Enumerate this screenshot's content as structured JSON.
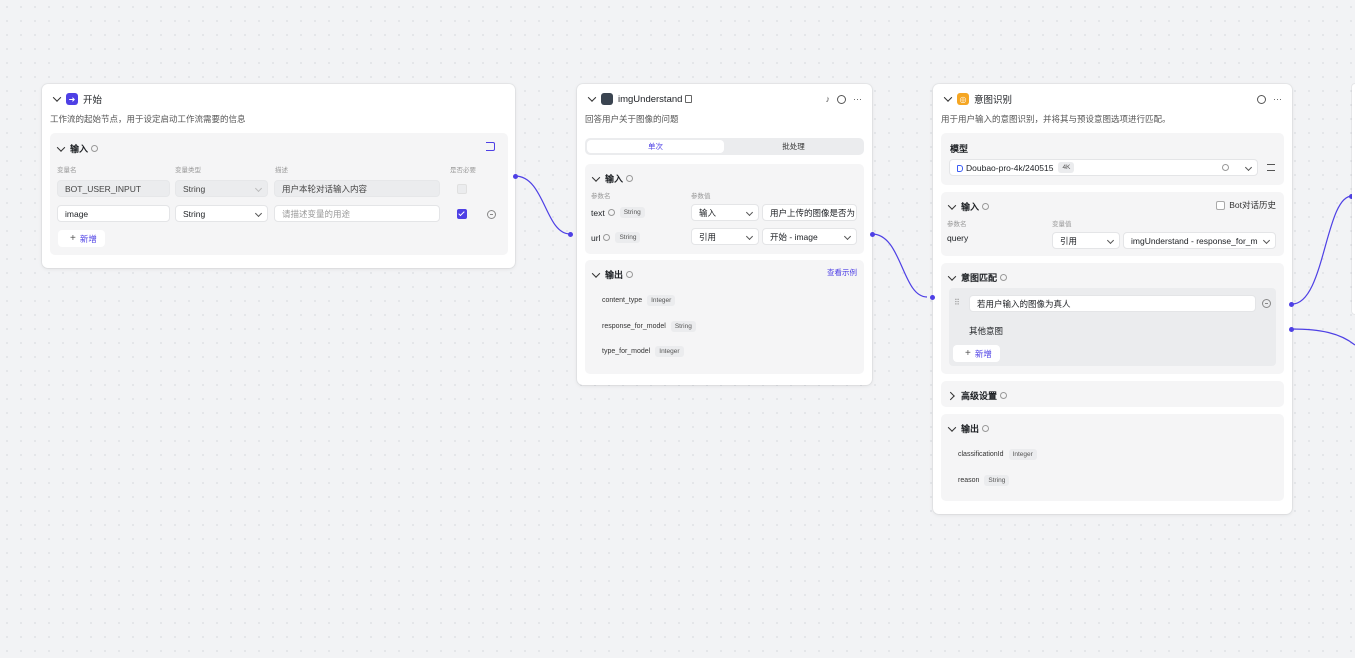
{
  "start_node": {
    "title": "开始",
    "description": "工作流的起始节点，用于设定启动工作流需要的信息",
    "input_section": "输入",
    "columns": [
      "变量名",
      "变量类型",
      "描述",
      "是否必要"
    ],
    "rows": [
      {
        "name": "BOT_USER_INPUT",
        "type": "String",
        "description": "用户本轮对话输入内容",
        "placeholder": ""
      },
      {
        "name": "image",
        "type": "String",
        "description": "",
        "placeholder": "请描述变量的用途"
      }
    ],
    "add_label": "新增"
  },
  "img_node": {
    "title": "imgUnderstand",
    "description": "回答用户关于图像的问题",
    "tabs": [
      "单次",
      "批处理"
    ],
    "input_section": "输入",
    "columns": [
      "参数名",
      "参数值"
    ],
    "params": [
      {
        "name": "text",
        "type": "String",
        "mode": "输入",
        "value": "用户上传的图像是否为"
      },
      {
        "name": "url",
        "type": "String",
        "mode": "引用",
        "value": "开始 - image"
      }
    ],
    "output_section": "输出",
    "view_example": "查看示例",
    "outputs": [
      {
        "name": "content_type",
        "type": "Integer"
      },
      {
        "name": "response_for_model",
        "type": "String"
      },
      {
        "name": "type_for_model",
        "type": "Integer"
      }
    ]
  },
  "intent_node": {
    "title": "意图识别",
    "description": "用于用户输入的意图识别，并将其与预设意图选项进行匹配。",
    "model_label": "模型",
    "model_name": "Doubao-pro-4k/240515",
    "model_badge": "4K",
    "input_section": "输入",
    "bot_history": "Bot对话历史",
    "columns": [
      "参数名",
      "变量值"
    ],
    "param": {
      "name": "query",
      "mode": "引用",
      "value": "imgUnderstand - response_for_m"
    },
    "match_section": "意图匹配",
    "intents": [
      "若用户输入的图像为真人"
    ],
    "other_intent": "其他意图",
    "add_label": "新增",
    "advanced": "高级设置",
    "output_section": "输出",
    "outputs": [
      {
        "name": "classificationId",
        "type": "Integer"
      },
      {
        "name": "reason",
        "type": "String"
      }
    ]
  },
  "colors": {
    "accent": "#4e40e5",
    "start_icon": "#4e40e5",
    "intent_icon": "#f5a623"
  }
}
